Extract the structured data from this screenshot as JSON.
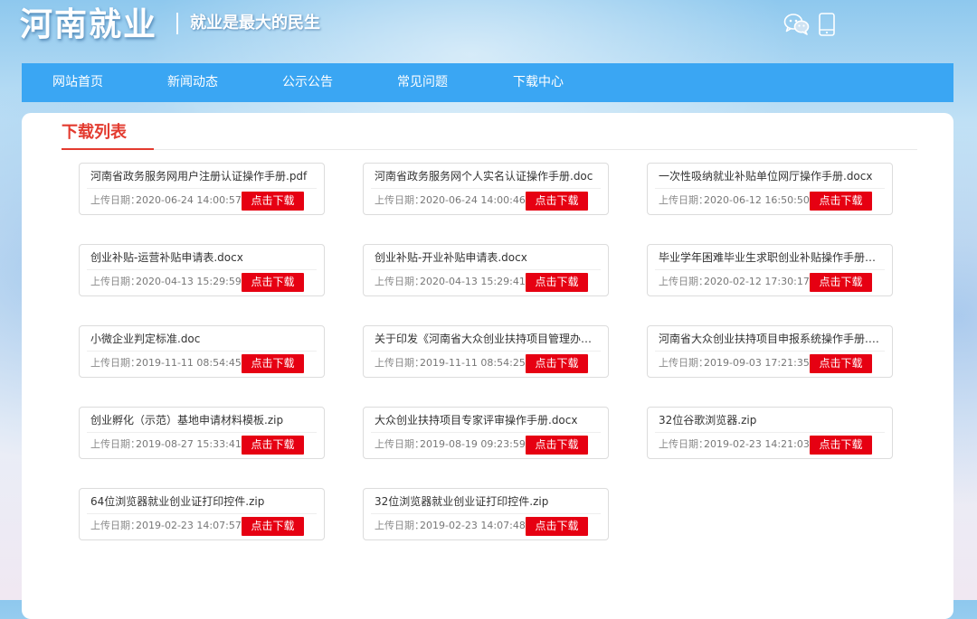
{
  "header": {
    "logo_text": "河南就业",
    "slogan": "就业是最大的民生",
    "icons": [
      "wechat-icon",
      "mobile-icon"
    ]
  },
  "nav": {
    "items": [
      "网站首页",
      "新闻动态",
      "公示公告",
      "常见问题",
      "下载中心"
    ]
  },
  "main": {
    "list_title": "下载列表",
    "date_label": "上传日期：",
    "download_label": "点击下载",
    "accent_color": "#e33b2f",
    "nav_color": "#3aa6f3",
    "button_color": "#e60012",
    "files": [
      {
        "name": "河南省政务服务网用户注册认证操作手册.pdf",
        "date": "2020-06-24 14:00:57"
      },
      {
        "name": "河南省政务服务网个人实名认证操作手册.doc",
        "date": "2020-06-24 14:00:46"
      },
      {
        "name": "一次性吸纳就业补贴单位网厅操作手册.docx",
        "date": "2020-06-12 16:50:50"
      },
      {
        "name": "创业补贴-运营补贴申请表.docx",
        "date": "2020-04-13 15:29:59"
      },
      {
        "name": "创业补贴-开业补贴申请表.docx",
        "date": "2020-04-13 15:29:41"
      },
      {
        "name": "毕业学年困难毕业生求职创业补贴操作手册（定...",
        "date": "2020-02-12 17:30:17"
      },
      {
        "name": "小微企业判定标准.doc",
        "date": "2019-11-11 08:54:45"
      },
      {
        "name": "关于印发《河南省大众创业扶持项目管理办法(试...",
        "date": "2019-11-11 08:54:25"
      },
      {
        "name": "河南省大众创业扶持项目申报系统操作手册.pdf",
        "date": "2019-09-03 17:21:35"
      },
      {
        "name": "创业孵化（示范）基地申请材料模板.zip",
        "date": "2019-08-27 15:33:41"
      },
      {
        "name": "大众创业扶持项目专家评审操作手册.docx",
        "date": "2019-08-19 09:23:59"
      },
      {
        "name": "32位谷歌浏览器.zip",
        "date": "2019-02-23 14:21:03"
      },
      {
        "name": "64位浏览器就业创业证打印控件.zip",
        "date": "2019-02-23 14:07:57"
      },
      {
        "name": "32位浏览器就业创业证打印控件.zip",
        "date": "2019-02-23 14:07:48"
      }
    ]
  }
}
